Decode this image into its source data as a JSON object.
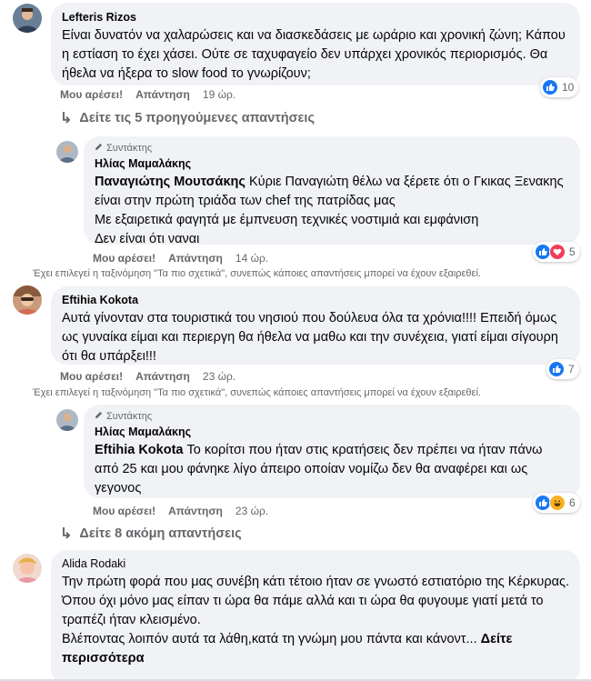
{
  "comments": [
    {
      "author": "Lefteris Rizos",
      "text": "Είναι δυνατόν να χαλαρώσεις και να διασκεδάσεις με ωράριο και χρονική ζώνη; Κάπου η εστίαση το έχει χάσει. Ούτε σε ταχυφαγείο δεν υπάρχει χρονικός περιορισμός. Θα ήθελα να ήξερα το slow food το γνωρίζουν;",
      "like_label": "Μου αρέσει!",
      "reply_label": "Απάντηση",
      "time": "19 ώρ.",
      "reaction_count": "10"
    },
    {
      "author": "Eftihia Kokota",
      "text": "Αυτά γίνονταν στα τουριστικά του νησιού που δούλευα όλα τα χρόνια!!!! Επειδή όμως ως γυναίκα είμαι και περιεργη θα ήθελα να μαθω και την συνέχεια, γιατί είμαι σίγουρη ότι θα υπάρξει!!!",
      "like_label": "Μου αρέσει!",
      "reply_label": "Απάντηση",
      "time": "23 ώρ.",
      "reaction_count": "7"
    },
    {
      "author": "Alida Rodaki",
      "text_lines": [
        "Την πρώτη φορά που μας συνέβη κάτι τέτοιο ήταν σε γνωστό εστιατόριο της Κέρκυρας.",
        "Όπου όχι μόνο μας είπαν τι ώρα θα πάμε αλλά και τι ώρα θα φυγουμε γιατί μετά το τραπέζι ήταν κλεισμένο.",
        "Βλέποντας λοιπόν αυτά τα λάθη,κατά τη γνώμη μου πάντα και κάνοντ..."
      ],
      "see_more": "Δείτε περισσότερα"
    }
  ],
  "replies": [
    {
      "role": "Συντάκτης",
      "author": "Ηλίας Μαμαλάκης",
      "mention": "Παναγιώτης Μουτσάκης",
      "text": " Κύριε Παναγιώτη θέλω να ξέρετε ότι ο Γκικας Ξενακης είναι στην πρώτη τριάδα των chef της πατρίδας μας",
      "extra_lines": [
        "Με εξαιρετικά φαγητά με έμπνευση τεχνικές νοστιμιά και εμφάνιση",
        "Δεν είναι ότι ναναι"
      ],
      "like_label": "Μου αρέσει!",
      "reply_label": "Απάντηση",
      "time": "14 ώρ.",
      "reaction_count": "5"
    },
    {
      "role": "Συντάκτης",
      "author": "Ηλίας Μαμαλάκης",
      "mention": "Eftihia Kokota",
      "text": " Το κορίτσι που ήταν στις κρατήσεις δεν πρέπει να ήταν πάνω από 25 και μου φάνηκε λίγο άπειρο οποίαν νομίζω δεν θα αναφέρει και ως γεγονος",
      "like_label": "Μου αρέσει!",
      "reply_label": "Απάντηση",
      "time": "23 ώρ.",
      "reaction_count": "6"
    }
  ],
  "more_replies": [
    "Δείτε τις 5 προηγούμενες απαντήσεις",
    "Δείτε 8 ακόμη απαντήσεις"
  ],
  "sort_notice": "Έχει επιλεγεί η ταξινόμηση \"Τα πιο σχετικά\", συνεπώς κάποιες απαντήσεις μπορεί να έχουν εξαιρεθεί.",
  "colors": {
    "like": "#1877f2",
    "love": "#f33e58",
    "haha": "#f7b125",
    "bubble": "#f0f2f5",
    "secondary_text": "#65676b"
  }
}
